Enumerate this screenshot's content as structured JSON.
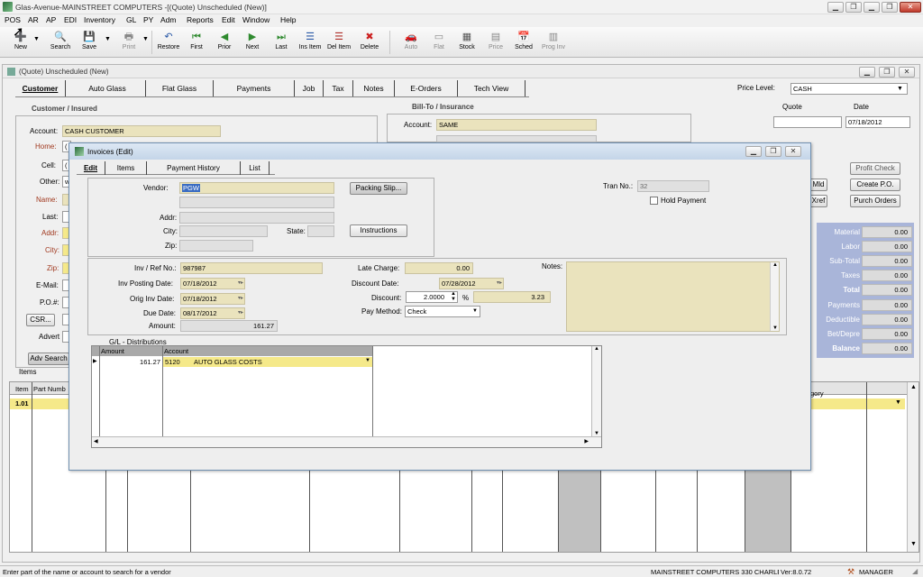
{
  "app": {
    "title": "Glas-Avenue-MAINSTREET COMPUTERS -[(Quote) Unscheduled (New)]"
  },
  "menu": [
    "POS",
    "AR",
    "AP",
    "EDI",
    "Inventory",
    "GL",
    "PY",
    "Adm",
    "Reports",
    "Edit",
    "Window",
    "Help"
  ],
  "toolbar": {
    "new": "New",
    "search": "Search",
    "save": "Save",
    "print": "Print",
    "restore": "Restore",
    "first": "First",
    "prior": "Prior",
    "next": "Next",
    "last": "Last",
    "ins_item": "Ins Item",
    "del_item": "Del Item",
    "delete": "Delete",
    "auto": "Auto",
    "flat": "Flat",
    "stock": "Stock",
    "price": "Price",
    "sched": "Sched",
    "prog_inv": "Prog Inv"
  },
  "quote_window": {
    "title": "(Quote) Unscheduled (New)",
    "tabs": [
      "Customer",
      "Auto Glass",
      "Flat Glass",
      "Payments",
      "Job",
      "Tax",
      "Notes",
      "E-Orders",
      "Tech View"
    ],
    "price_level_label": "Price Level:",
    "price_level_value": "CASH",
    "customer_section": "Customer / Insured",
    "billto_section": "Bill-To / Insurance",
    "quote_label": "Quote",
    "date_label": "Date",
    "date_value": "07/18/2012",
    "fields": {
      "account_label": "Account:",
      "account_value": "CASH CUSTOMER",
      "home_label": "Home:",
      "home_value": "(",
      "cell_label": "Cell:",
      "cell_value": "(",
      "other_label": "Other:",
      "other_value": "w",
      "name_label": "Name:",
      "last_label": "Last:",
      "addr_label": "Addr:",
      "city_label": "City:",
      "zip_label": "Zip:",
      "email_label": "E-Mail:",
      "po_label": "P.O.#:",
      "advert_label": "Advert",
      "billto_account_label": "Account:",
      "billto_account_value": "SAME"
    },
    "csr_btn": "CSR...",
    "adv_search_btn": "Adv Search",
    "items_label": "Items",
    "right_buttons": {
      "profit_check": "Profit Check",
      "create_po": "Create P.O.",
      "purch_orders": "Purch Orders",
      "mld": "Mld",
      "xref": "Xref"
    },
    "summary": [
      {
        "label": "Material",
        "value": "0.00"
      },
      {
        "label": "Labor",
        "value": "0.00"
      },
      {
        "label": "Sub-Total",
        "value": "0.00"
      },
      {
        "label": "Taxes",
        "value": "0.00"
      },
      {
        "label": "Total",
        "value": "0.00"
      },
      {
        "label": "Payments",
        "value": "0.00"
      },
      {
        "label": "Deductible",
        "value": "0.00"
      },
      {
        "label": "Bet/Depre",
        "value": "0.00"
      },
      {
        "label": "Balance",
        "value": "0.00"
      }
    ],
    "grid": {
      "col_item": "Item",
      "col_part": "Part Numb",
      "col_category": "gory",
      "row_item": "1.01"
    }
  },
  "invoice_dialog": {
    "title": "Invoices (Edit)",
    "tabs": [
      "Edit",
      "Items",
      "Payment History",
      "List"
    ],
    "vendor_label": "Vendor:",
    "vendor_value": "PGW",
    "packing_slip_btn": "Packing Slip...",
    "addr_label": "Addr:",
    "city_label": "City:",
    "state_label": "State:",
    "zip_label": "Zip:",
    "instructions_btn": "Instructions",
    "tran_no_label": "Tran No.:",
    "tran_no_value": "32",
    "hold_payment_label": "Hold Payment",
    "inv_ref_label": "Inv / Ref No.:",
    "inv_ref_value": "987987",
    "inv_posting_label": "Inv Posting Date:",
    "inv_posting_value": "07/18/2012",
    "orig_inv_label": "Orig Inv Date:",
    "orig_inv_value": "07/18/2012",
    "due_date_label": "Due Date:",
    "due_date_value": "08/17/2012",
    "amount_label": "Amount:",
    "amount_value": "161.27",
    "late_charge_label": "Late Charge:",
    "late_charge_value": "0.00",
    "discount_date_label": "Discount Date:",
    "discount_date_value": "07/28/2012",
    "discount_label": "Discount:",
    "discount_pct": "2.0000",
    "pct_sign": "%",
    "discount_amt": "3.23",
    "pay_method_label": "Pay Method:",
    "pay_method_value": "Check",
    "notes_label": "Notes:",
    "gl_title": "G/L - Distributions",
    "gl_col_amount": "Amount",
    "gl_col_account": "Account",
    "gl_row_amount": "161.27",
    "gl_row_acct": "5120",
    "gl_row_desc": "AUTO GLASS COSTS"
  },
  "status": {
    "hint": "Enter part of the name or account to search for a vendor",
    "company": "MAINSTREET COMPUTERS 330 CHARLES",
    "version": "Ver:8.0.72",
    "user": "MANAGER"
  }
}
